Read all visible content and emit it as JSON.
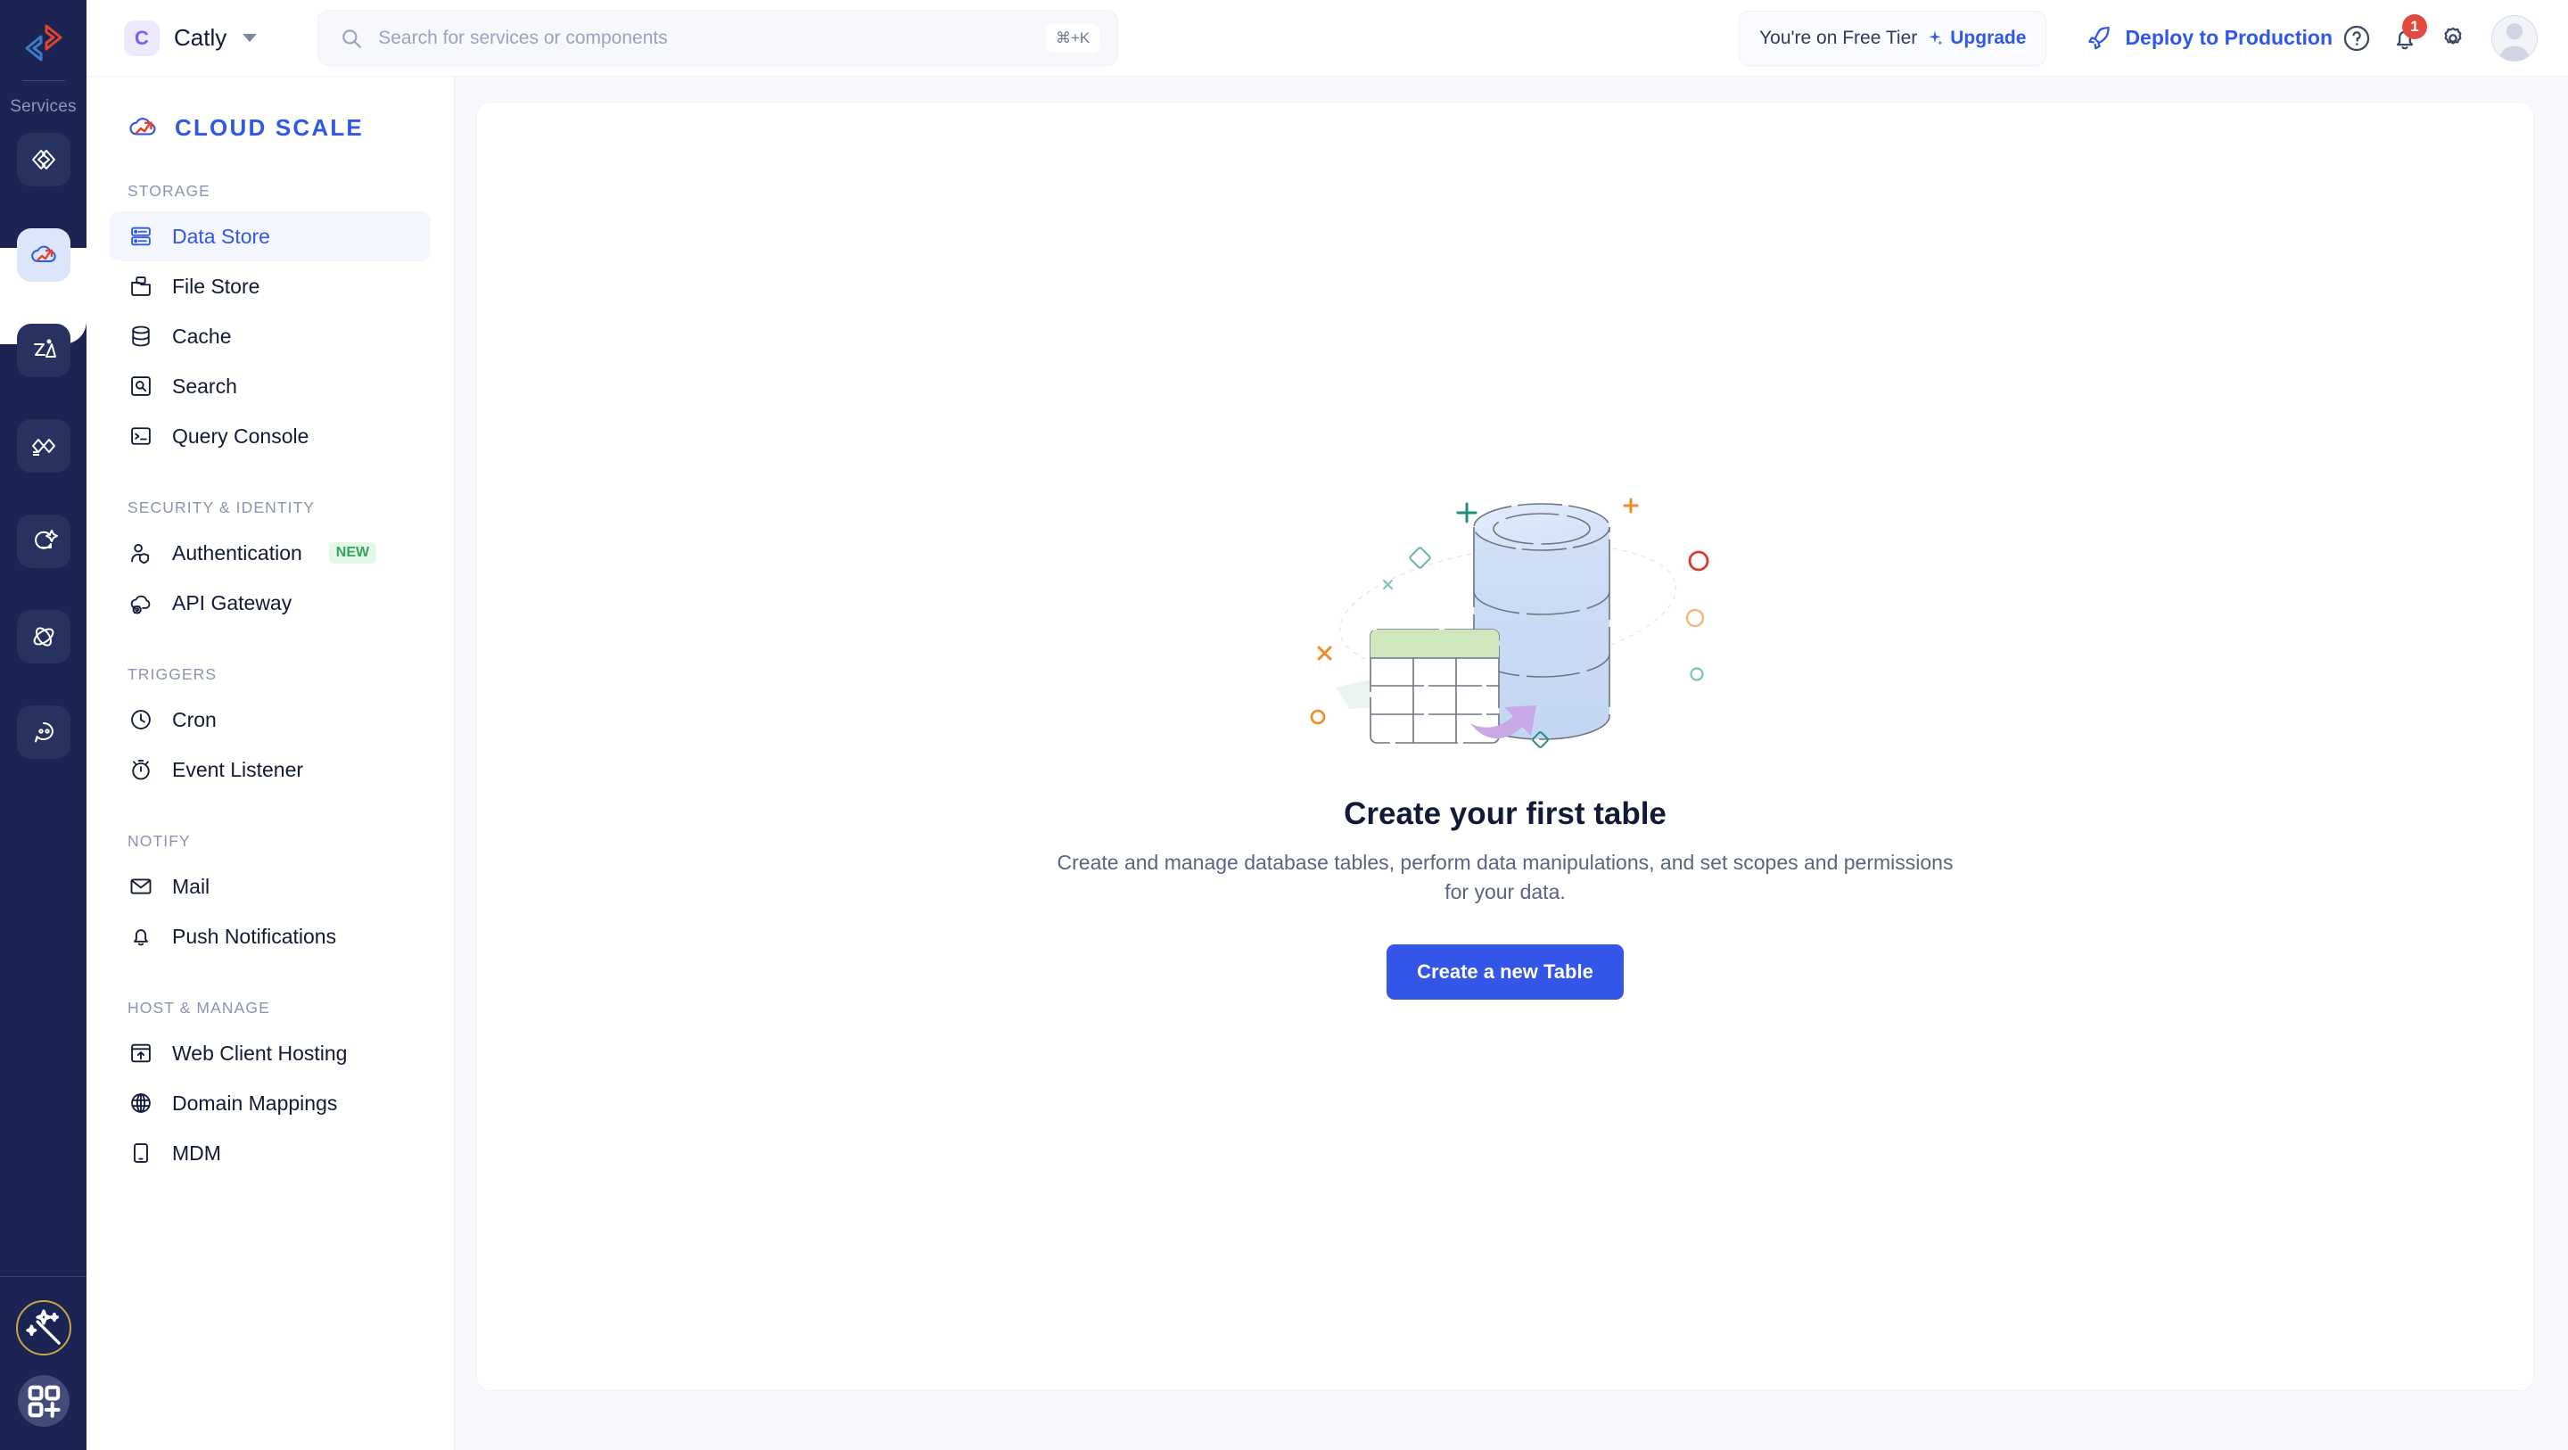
{
  "rail": {
    "logo_icon": "brand-chevron-logo",
    "section_label": "Services",
    "items": [
      {
        "name": "code-braces-icon",
        "active": false
      },
      {
        "name": "cloud-scale-icon",
        "active": true
      },
      {
        "name": "media-image-icon",
        "active": false
      },
      {
        "name": "connect-diamonds-icon",
        "active": false
      },
      {
        "name": "ai-sparkle-chat-icon",
        "active": false
      },
      {
        "name": "orbit-swirl-icon",
        "active": false
      },
      {
        "name": "chat-bubble-icon",
        "active": false
      }
    ],
    "bottom": [
      {
        "name": "magic-wand-icon"
      },
      {
        "name": "app-grid-plus-icon"
      }
    ]
  },
  "header": {
    "org": {
      "initial": "C",
      "name": "Catly",
      "caret_icon": "chevron-down-icon"
    },
    "search": {
      "placeholder": "Search for services or components",
      "value": "",
      "shortcut": "⌘+K",
      "icon": "search-icon"
    },
    "tier": {
      "text": "You're on Free Tier",
      "upgrade_label": "Upgrade",
      "upgrade_icon": "sparkle-icon"
    },
    "deploy": {
      "label": "Deploy to Production",
      "icon": "rocket-icon"
    },
    "help_icon": "question-circle-icon",
    "notifications": {
      "icon": "bell-icon",
      "count": "1"
    },
    "settings_icon": "gear-icon",
    "avatar_icon": "user-avatar"
  },
  "sidebar": {
    "brand": {
      "title": "CLOUD SCALE",
      "icon": "cloud-scale-icon",
      "accent": "#2f57e8"
    },
    "sections": [
      {
        "title": "STORAGE",
        "items": [
          {
            "label": "Data Store",
            "icon": "server-rows-icon",
            "active": true,
            "badge": ""
          },
          {
            "label": "File Store",
            "icon": "folder-file-icon",
            "active": false,
            "badge": ""
          },
          {
            "label": "Cache",
            "icon": "database-stack-icon",
            "active": false,
            "badge": ""
          },
          {
            "label": "Search",
            "icon": "search-box-icon",
            "active": false,
            "badge": ""
          },
          {
            "label": "Query Console",
            "icon": "terminal-prompt-icon",
            "active": false,
            "badge": ""
          }
        ]
      },
      {
        "title": "SECURITY & IDENTITY",
        "items": [
          {
            "label": "Authentication",
            "icon": "user-shield-icon",
            "active": false,
            "badge": "NEW"
          },
          {
            "label": "API Gateway",
            "icon": "cloud-gear-icon",
            "active": false,
            "badge": ""
          }
        ]
      },
      {
        "title": "TRIGGERS",
        "items": [
          {
            "label": "Cron",
            "icon": "clock-icon",
            "active": false,
            "badge": ""
          },
          {
            "label": "Event Listener",
            "icon": "stopwatch-icon",
            "active": false,
            "badge": ""
          }
        ]
      },
      {
        "title": "NOTIFY",
        "items": [
          {
            "label": "Mail",
            "icon": "envelope-icon",
            "active": false,
            "badge": ""
          },
          {
            "label": "Push Notifications",
            "icon": "bell-icon",
            "active": false,
            "badge": ""
          }
        ]
      },
      {
        "title": "HOST & MANAGE",
        "items": [
          {
            "label": "Web Client Hosting",
            "icon": "window-upload-icon",
            "active": false,
            "badge": ""
          },
          {
            "label": "Domain Mappings",
            "icon": "globe-icon",
            "active": false,
            "badge": ""
          },
          {
            "label": "MDM",
            "icon": "mobile-device-icon",
            "active": false,
            "badge": ""
          }
        ]
      }
    ]
  },
  "main": {
    "empty_state": {
      "illustration": "database-table-illustration",
      "title": "Create your first table",
      "description": "Create and manage database tables, perform data manipulations, and set scopes and permissions for your data.",
      "cta_label": "Create a new Table"
    }
  },
  "colors": {
    "rail_bg": "#1b2452",
    "accent_blue": "#2f57e8",
    "cta_blue": "#3355e8",
    "badge_red": "#e24a3f",
    "new_green": "#35a45c",
    "page_bg": "#f7f8fc"
  }
}
